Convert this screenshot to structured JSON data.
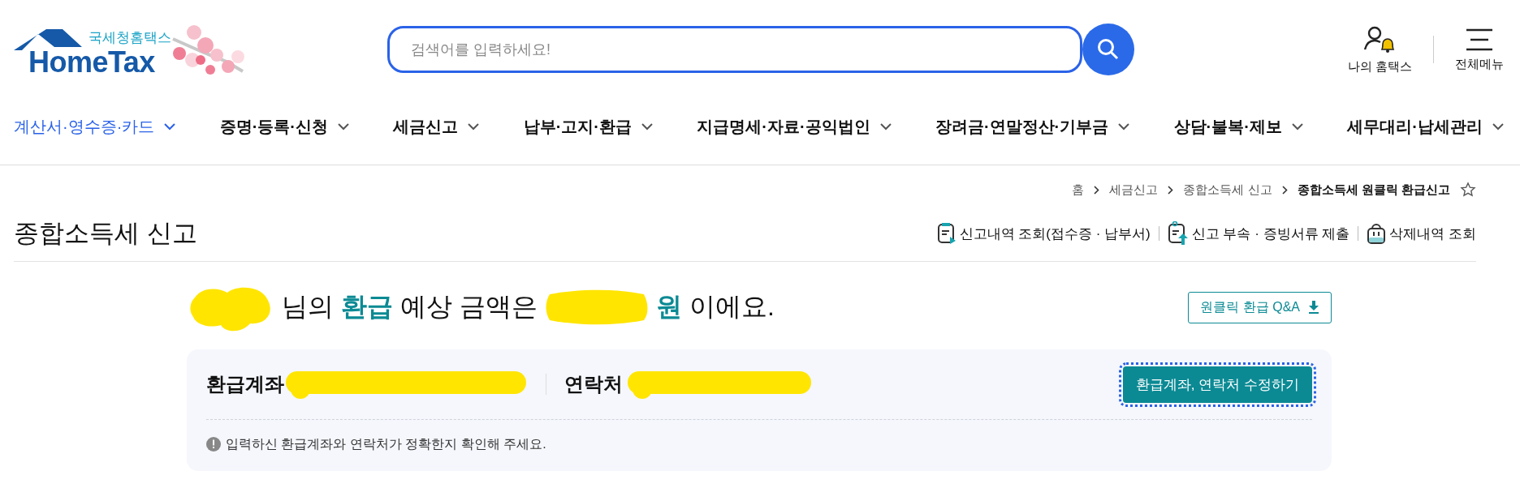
{
  "logo": {
    "tagline": "국세청홈택스",
    "wordmark": "HomeTax"
  },
  "search": {
    "placeholder": "검색어를 입력하세요!"
  },
  "utility_links": [
    {
      "label": "나의 홈택스",
      "kind": "account"
    },
    {
      "label": "전체메뉴",
      "kind": "menu"
    }
  ],
  "nav": [
    {
      "label": "계산서·영수증·카드",
      "selected": true
    },
    {
      "label": "증명·등록·신청",
      "selected": false
    },
    {
      "label": "세금신고",
      "selected": false
    },
    {
      "label": "납부·고지·환급",
      "selected": false
    },
    {
      "label": "지급명세·자료·공익법인",
      "selected": false
    },
    {
      "label": "장려금·연말정산·기부금",
      "selected": false
    },
    {
      "label": "상담·불복·제보",
      "selected": false
    },
    {
      "label": "세무대리·납세관리",
      "selected": false
    }
  ],
  "breadcrumb": [
    {
      "label": "홈",
      "current": false
    },
    {
      "label": "세금신고",
      "current": false
    },
    {
      "label": "종합소득세 신고",
      "current": false
    },
    {
      "label": "종합소득세 원클릭 환급신고",
      "current": true
    }
  ],
  "page_title": "종합소득세 신고",
  "page_actions": [
    {
      "label": "신고내역 조회(접수증 · 납부서)",
      "kind": "receipt"
    },
    {
      "label": "신고 부속 · 증빙서류 제출",
      "kind": "upload"
    },
    {
      "label": "삭제내역 조회",
      "kind": "trash"
    }
  ],
  "greeting": [
    {
      "kind": "redacted"
    },
    {
      "kind": "text",
      "text": "님의"
    },
    {
      "kind": "highlight",
      "text": "환급"
    },
    {
      "kind": "text",
      "text": "예상 금액은"
    },
    {
      "kind": "redacted"
    },
    {
      "kind": "highlight",
      "text": "원"
    },
    {
      "kind": "text",
      "text": "이에요."
    }
  ],
  "qa_button": "원클릭 환급 Q&A",
  "refund_card": {
    "account_label": "환급계좌",
    "contact_label": "연락처",
    "edit_button": {
      "label": "환급계좌, 연락처 수정하기",
      "focused": true
    },
    "note": "입력하신 환급계좌와 연락처가 정확한지 확인해 주세요."
  }
}
